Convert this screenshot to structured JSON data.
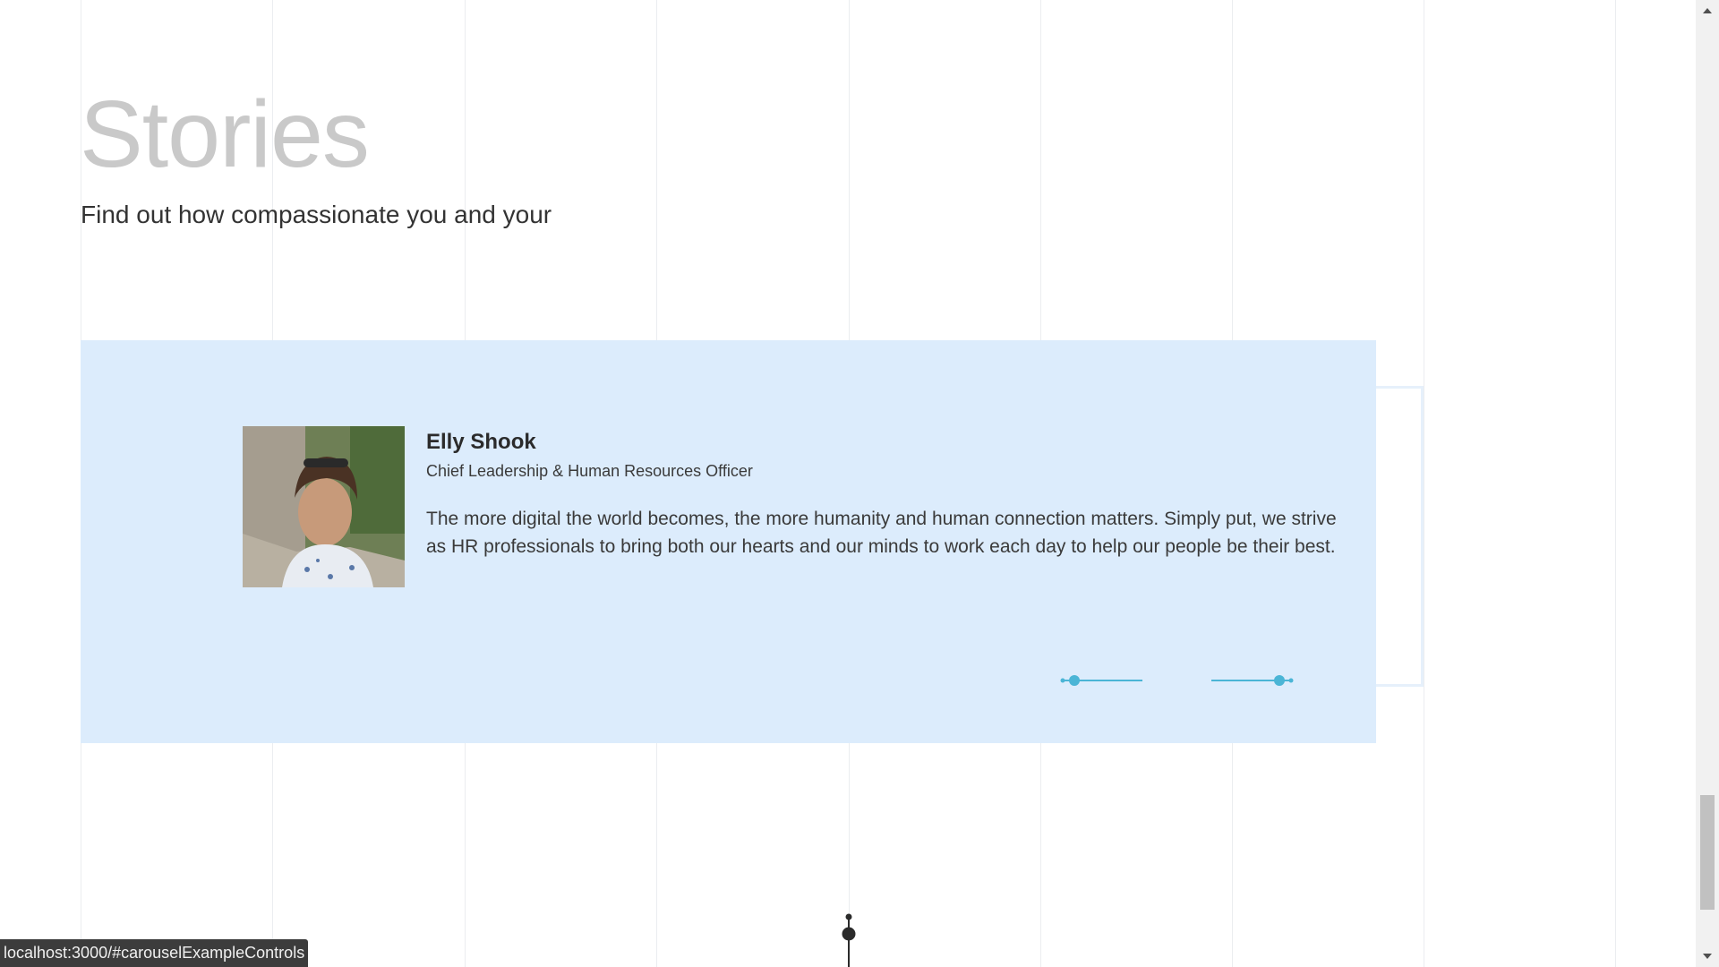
{
  "section": {
    "title": "Stories",
    "subtitle": "Find out how compassionate you and your"
  },
  "story": {
    "name": "Elly Shook",
    "role": "Chief Leadership & Human Resources Officer",
    "quote": "The more digital the world becomes, the more humanity and human connection matters. Simply put, we strive as HR professionals to bring both our hearts and our minds to work each day to help our people be their best."
  },
  "carousel": {
    "prev_icon": "line-arrow-left-icon",
    "next_icon": "line-arrow-right-icon"
  },
  "status_bar": {
    "url": "localhost:3000/#carouselExampleControls"
  },
  "colors": {
    "card_background": "#dcecfc",
    "accent": "#4bb5d6",
    "title": "#c9c9c9"
  }
}
